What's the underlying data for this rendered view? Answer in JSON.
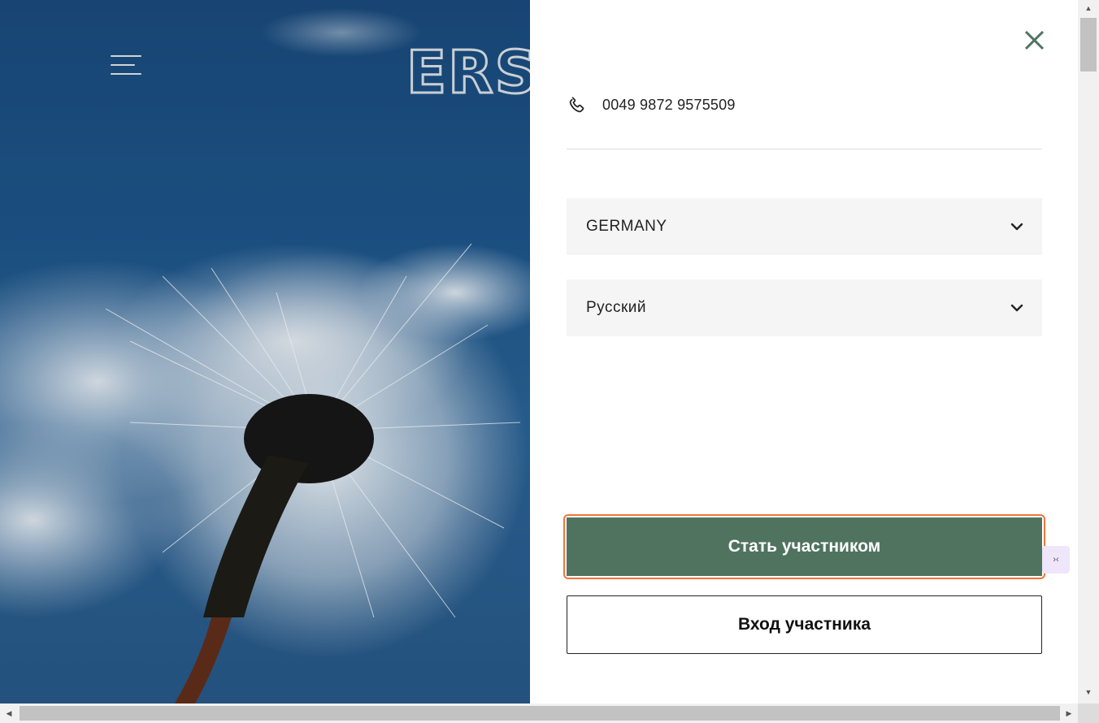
{
  "header": {
    "logo_text": "ERSN"
  },
  "panel": {
    "phone": "0049 9872 9575509",
    "country_select": {
      "value": "GERMANY"
    },
    "language_select": {
      "value": "Русский"
    },
    "primary_button": "Стать участником",
    "secondary_button": "Вход участника"
  },
  "colors": {
    "primary_green": "#507360",
    "focus_orange": "#f0743a",
    "close_green": "#507360"
  },
  "icons": [
    "menu-icon",
    "close-icon",
    "phone-icon",
    "chevron-down-icon"
  ]
}
